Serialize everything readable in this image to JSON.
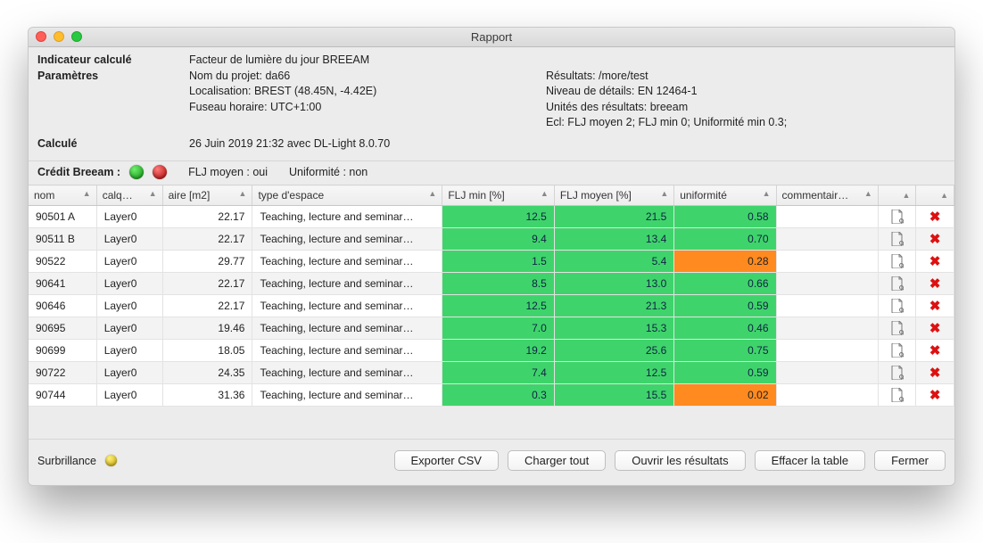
{
  "window": {
    "title": "Rapport"
  },
  "header": {
    "labels": {
      "indicator": "Indicateur calculé",
      "params": "Paramètres",
      "calc": "Calculé"
    },
    "indicator_value": "Facteur de lumière du jour BREEAM",
    "project": "Nom du projet: da66",
    "location": "Localisation: BREST (48.45N, -4.42E)",
    "timezone": "Fuseau horaire: UTC+1:00",
    "calculated": "26 Juin 2019 21:32 avec DL-Light 8.0.70",
    "right": {
      "results": "Résultats: /more/test",
      "detail": "Niveau de détails: EN 12464-1",
      "units": "Unités des résultats: breeam",
      "ecl": "Ecl: FLJ moyen 2; FLJ min 0; Uniformité min 0.3;"
    }
  },
  "credit": {
    "label": "Crédit Breeam :",
    "led1": "green",
    "led2": "red",
    "avg": "FLJ moyen : oui",
    "unif": "Uniformité : non"
  },
  "columns": {
    "nom": "nom",
    "calq": "calq…",
    "aire": "aire [m2]",
    "type": "type d'espace",
    "fljmin": "FLJ min [%]",
    "fljmoy": "FLJ moyen [%]",
    "unif": "uniformité",
    "comm": "commentair…"
  },
  "rows": [
    {
      "nom": "90501 A",
      "calq": "Layer0",
      "aire": "22.17",
      "type": "Teaching, lecture and seminar…",
      "fljmin": "12.5",
      "fljmin_c": "green",
      "fljmoy": "21.5",
      "fljmoy_c": "green",
      "unif": "0.58",
      "unif_c": "green",
      "comm": ""
    },
    {
      "nom": "90511 B",
      "calq": "Layer0",
      "aire": "22.17",
      "type": "Teaching, lecture and seminar…",
      "fljmin": "9.4",
      "fljmin_c": "green",
      "fljmoy": "13.4",
      "fljmoy_c": "green",
      "unif": "0.70",
      "unif_c": "green",
      "comm": ""
    },
    {
      "nom": "90522",
      "calq": "Layer0",
      "aire": "29.77",
      "type": "Teaching, lecture and seminar…",
      "fljmin": "1.5",
      "fljmin_c": "green",
      "fljmoy": "5.4",
      "fljmoy_c": "green",
      "unif": "0.28",
      "unif_c": "orange",
      "comm": ""
    },
    {
      "nom": "90641",
      "calq": "Layer0",
      "aire": "22.17",
      "type": "Teaching, lecture and seminar…",
      "fljmin": "8.5",
      "fljmin_c": "green",
      "fljmoy": "13.0",
      "fljmoy_c": "green",
      "unif": "0.66",
      "unif_c": "green",
      "comm": ""
    },
    {
      "nom": "90646",
      "calq": "Layer0",
      "aire": "22.17",
      "type": "Teaching, lecture and seminar…",
      "fljmin": "12.5",
      "fljmin_c": "green",
      "fljmoy": "21.3",
      "fljmoy_c": "green",
      "unif": "0.59",
      "unif_c": "green",
      "comm": ""
    },
    {
      "nom": "90695",
      "calq": "Layer0",
      "aire": "19.46",
      "type": "Teaching, lecture and seminar…",
      "fljmin": "7.0",
      "fljmin_c": "green",
      "fljmoy": "15.3",
      "fljmoy_c": "green",
      "unif": "0.46",
      "unif_c": "green",
      "comm": ""
    },
    {
      "nom": "90699",
      "calq": "Layer0",
      "aire": "18.05",
      "type": "Teaching, lecture and seminar…",
      "fljmin": "19.2",
      "fljmin_c": "green",
      "fljmoy": "25.6",
      "fljmoy_c": "green",
      "unif": "0.75",
      "unif_c": "green",
      "comm": ""
    },
    {
      "nom": "90722",
      "calq": "Layer0",
      "aire": "24.35",
      "type": "Teaching, lecture and seminar…",
      "fljmin": "7.4",
      "fljmin_c": "green",
      "fljmoy": "12.5",
      "fljmoy_c": "green",
      "unif": "0.59",
      "unif_c": "green",
      "comm": ""
    },
    {
      "nom": "90744",
      "calq": "Layer0",
      "aire": "31.36",
      "type": "Teaching, lecture and seminar…",
      "fljmin": "0.3",
      "fljmin_c": "green",
      "fljmoy": "15.5",
      "fljmoy_c": "green",
      "unif": "0.02",
      "unif_c": "orange",
      "comm": ""
    }
  ],
  "footer": {
    "highlight": "Surbrillance",
    "export": "Exporter CSV",
    "load": "Charger tout",
    "open": "Ouvrir les résultats",
    "clear": "Effacer la table",
    "close": "Fermer"
  }
}
